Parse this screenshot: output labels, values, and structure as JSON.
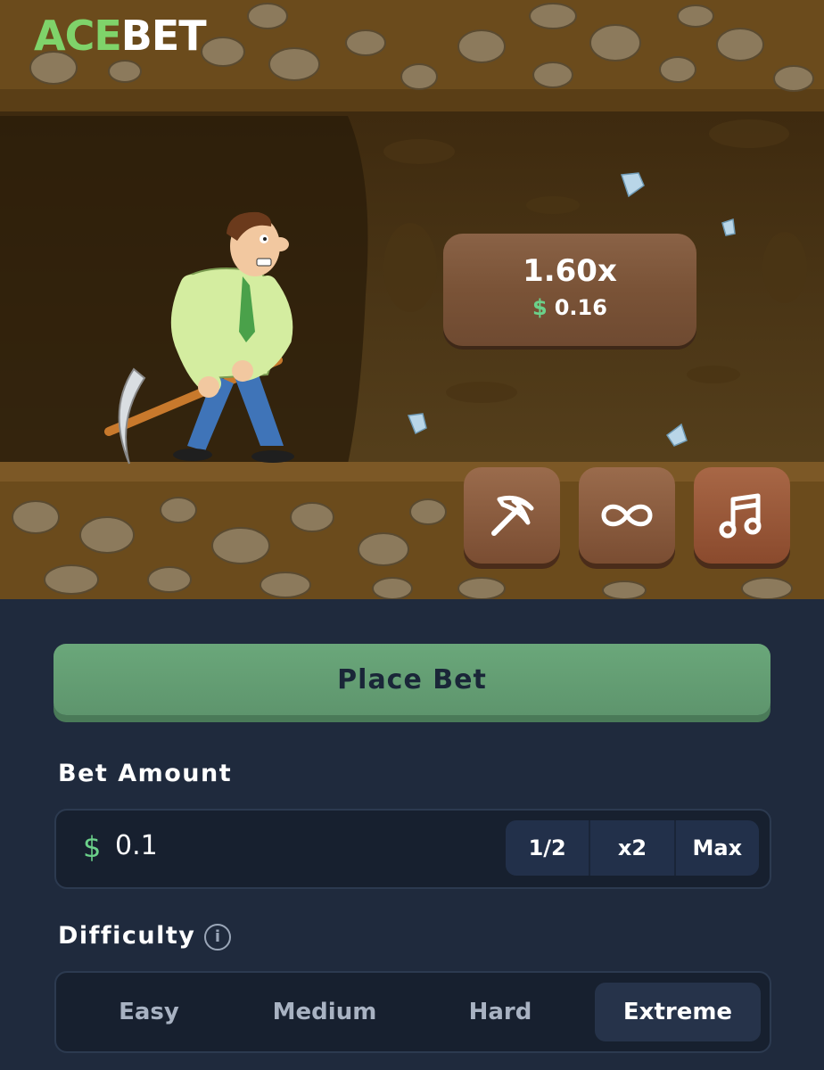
{
  "brand": {
    "part1": "ACE",
    "part2": "BET"
  },
  "game": {
    "multiplier": "1.60x",
    "payout_currency": "$",
    "payout_value": "0.16",
    "tools": [
      {
        "name": "pickaxe",
        "icon": "pickaxe-icon"
      },
      {
        "name": "autoplay",
        "icon": "infinity-icon"
      },
      {
        "name": "music",
        "icon": "music-note-icon"
      }
    ]
  },
  "controls": {
    "place_bet_label": "Place Bet",
    "bet_amount_label": "Bet Amount",
    "bet_currency": "$",
    "bet_value": "0.1",
    "half_label": "1/2",
    "double_label": "x2",
    "max_label": "Max",
    "difficulty_label": "Difficulty",
    "info_glyph": "i",
    "difficulties": [
      "Easy",
      "Medium",
      "Hard",
      "Extreme"
    ],
    "selected_difficulty": "Extreme"
  },
  "colors": {
    "accent_green": "#6bd18a",
    "button_green": "#6aa77a",
    "panel_bg": "#1f2a3d"
  }
}
